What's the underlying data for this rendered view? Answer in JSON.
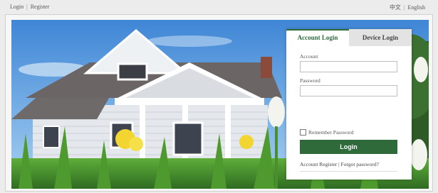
{
  "topbar": {
    "login": "Login",
    "register": "Register",
    "lang_cn": "中文",
    "lang_en": "English",
    "separator": "|"
  },
  "login_panel": {
    "tabs": [
      {
        "label": "Account Login",
        "active": true
      },
      {
        "label": "Device Login",
        "active": false
      }
    ],
    "account_label": "Account",
    "account_value": "",
    "password_label": "Password",
    "password_value": "",
    "remember_label": "Remember Password",
    "remember_checked": false,
    "login_button": "Login",
    "register_link": "Account Register",
    "forgot_link": "Forgot password?",
    "link_separator": "|"
  },
  "colors": {
    "accent": "#2e6a3a",
    "sky": "#6aa9e0"
  }
}
